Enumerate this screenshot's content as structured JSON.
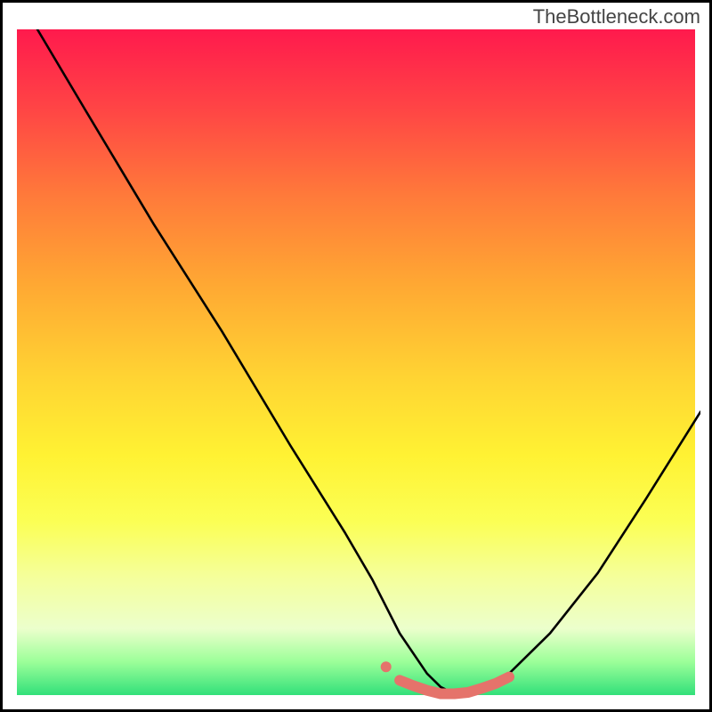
{
  "watermark": "TheBottleneck.com",
  "colors": {
    "curve": "#000000",
    "marker": "#e5736b",
    "border": "#000000"
  },
  "chart_data": {
    "type": "line",
    "title": "",
    "xlabel": "",
    "ylabel": "",
    "xlim": [
      0,
      100
    ],
    "ylim": [
      0,
      100
    ],
    "x": [
      3,
      10,
      20,
      30,
      40,
      48,
      52,
      56,
      60,
      62,
      64,
      66,
      68,
      72,
      78,
      85,
      92,
      100
    ],
    "values": [
      100,
      88,
      71,
      55,
      38,
      25,
      18,
      10,
      4,
      2,
      1,
      1,
      2,
      4,
      10,
      19,
      30,
      43
    ],
    "highlight": {
      "x": [
        54,
        56,
        58,
        60,
        62,
        64,
        66,
        68,
        70,
        72
      ],
      "values": [
        5,
        3,
        2.2,
        1.5,
        1,
        1,
        1.2,
        1.8,
        2.5,
        3.5
      ]
    }
  }
}
